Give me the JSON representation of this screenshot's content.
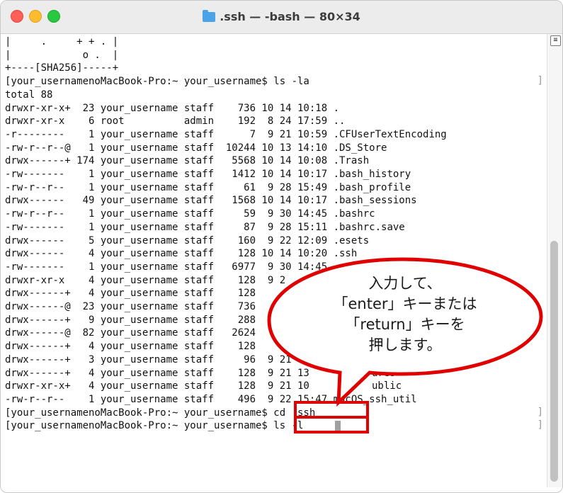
{
  "window": {
    "title": ".ssh — -bash — 80×34",
    "folder_icon": "folder-icon",
    "buttons": [
      "close",
      "minimize",
      "zoom"
    ]
  },
  "terminal": {
    "lines": [
      "|     .     + + . |",
      "|            o .  |",
      "+----[SHA256]-----+",
      "[your_usernamenoMacBook-Pro:~ your_username$ ls -la",
      "total 88",
      "drwxr-xr-x+  23 your_username staff    736 10 14 10:18 .",
      "drwxr-xr-x    6 root          admin    192  8 24 17:59 ..",
      "-r--------    1 your_username staff      7  9 21 10:59 .CFUserTextEncoding",
      "-rw-r--r--@   1 your_username staff  10244 10 13 14:10 .DS_Store",
      "drwx------+ 174 your_username staff   5568 10 14 10:08 .Trash",
      "-rw-------    1 your_username staff   1412 10 14 10:17 .bash_history",
      "-rw-r--r--    1 your_username staff     61  9 28 15:49 .bash_profile",
      "drwx------   49 your_username staff   1568 10 14 10:17 .bash_sessions",
      "-rw-r--r--    1 your_username staff     59  9 30 14:45 .bashrc",
      "-rw-------    1 your_username staff     87  9 28 15:11 .bashrc.save",
      "drwx------    5 your_username staff    160  9 22 12:09 .esets",
      "drwx------    4 your_username staff    128 10 14 10:20 .ssh",
      "-rw-------    1 your_username staff   6977  9 30 14:45 .v",
      "drwxr-xr-x    4 your_username staff    128  9 2",
      "drwx------+   4 your_username staff    128",
      "drwx------@  23 your_username staff    736",
      "drwx------+   9 your_username staff    288",
      "drwx------@  82 your_username staff   2624",
      "drwx------+   4 your_username staff    128",
      "drwx------+   3 your_username staff     96  9 21",
      "drwx------+   4 your_username staff    128  9 21 13",
      "drwxr-xr-x+   4 your_username staff    128  9 21 10",
      "-rw-r--r--    1 your_username staff    496  9 22 15:47 macOS_ssh_util",
      "[your_usernamenoMacBook-Pro:~ your_username$ cd .ssh",
      "[your_usernamenoMacBook-Pro:~ your_username$ ls -l"
    ],
    "partial_fragments": [
      "ures",
      "ublic"
    ],
    "prompt_indicator": "]"
  },
  "callout": {
    "lines": [
      "入力して、",
      "「enter」キーまたは",
      "「return」キーを",
      "押します。"
    ],
    "color": "#e00000"
  },
  "scrollbar": {
    "menu_icon": "≡"
  }
}
